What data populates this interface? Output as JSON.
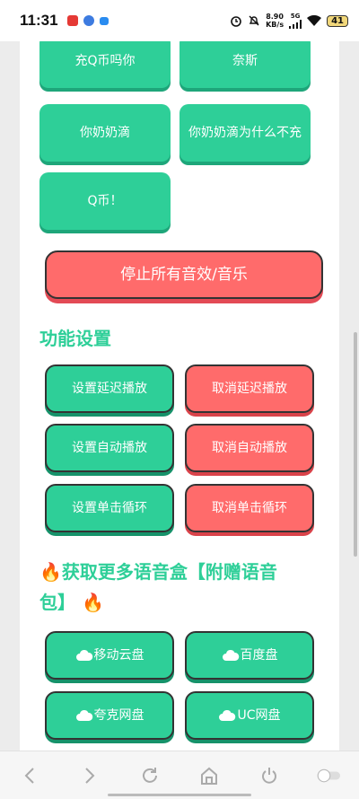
{
  "status": {
    "time": "11:31",
    "speed_top": "8.90",
    "speed_bottom": "KB/s",
    "network": "5G",
    "battery": "41"
  },
  "top_buttons": [
    "充Q币吗你",
    "奈斯",
    "你奶奶滴",
    "你奶奶滴为什么不充",
    "Q币！"
  ],
  "stop_button": "停止所有音效/音乐",
  "settings": {
    "title": "功能设置",
    "set_delay": "设置延迟播放",
    "cancel_delay": "取消延迟播放",
    "set_auto": "设置自动播放",
    "cancel_auto": "取消自动播放",
    "set_loop": "设置单击循环",
    "cancel_loop": "取消单击循环"
  },
  "more": {
    "fire": "🔥",
    "title": "获取更多语音盒【附赠语音包】",
    "buttons": [
      "移动云盘",
      "百度盘",
      "夸克网盘",
      "UC网盘"
    ]
  },
  "colors": {
    "accent": "#2ecf98",
    "danger": "#ff6b6b"
  },
  "nav_icons": [
    "back-icon",
    "forward-icon",
    "refresh-icon",
    "home-icon",
    "power-icon",
    "toggle-icon"
  ]
}
